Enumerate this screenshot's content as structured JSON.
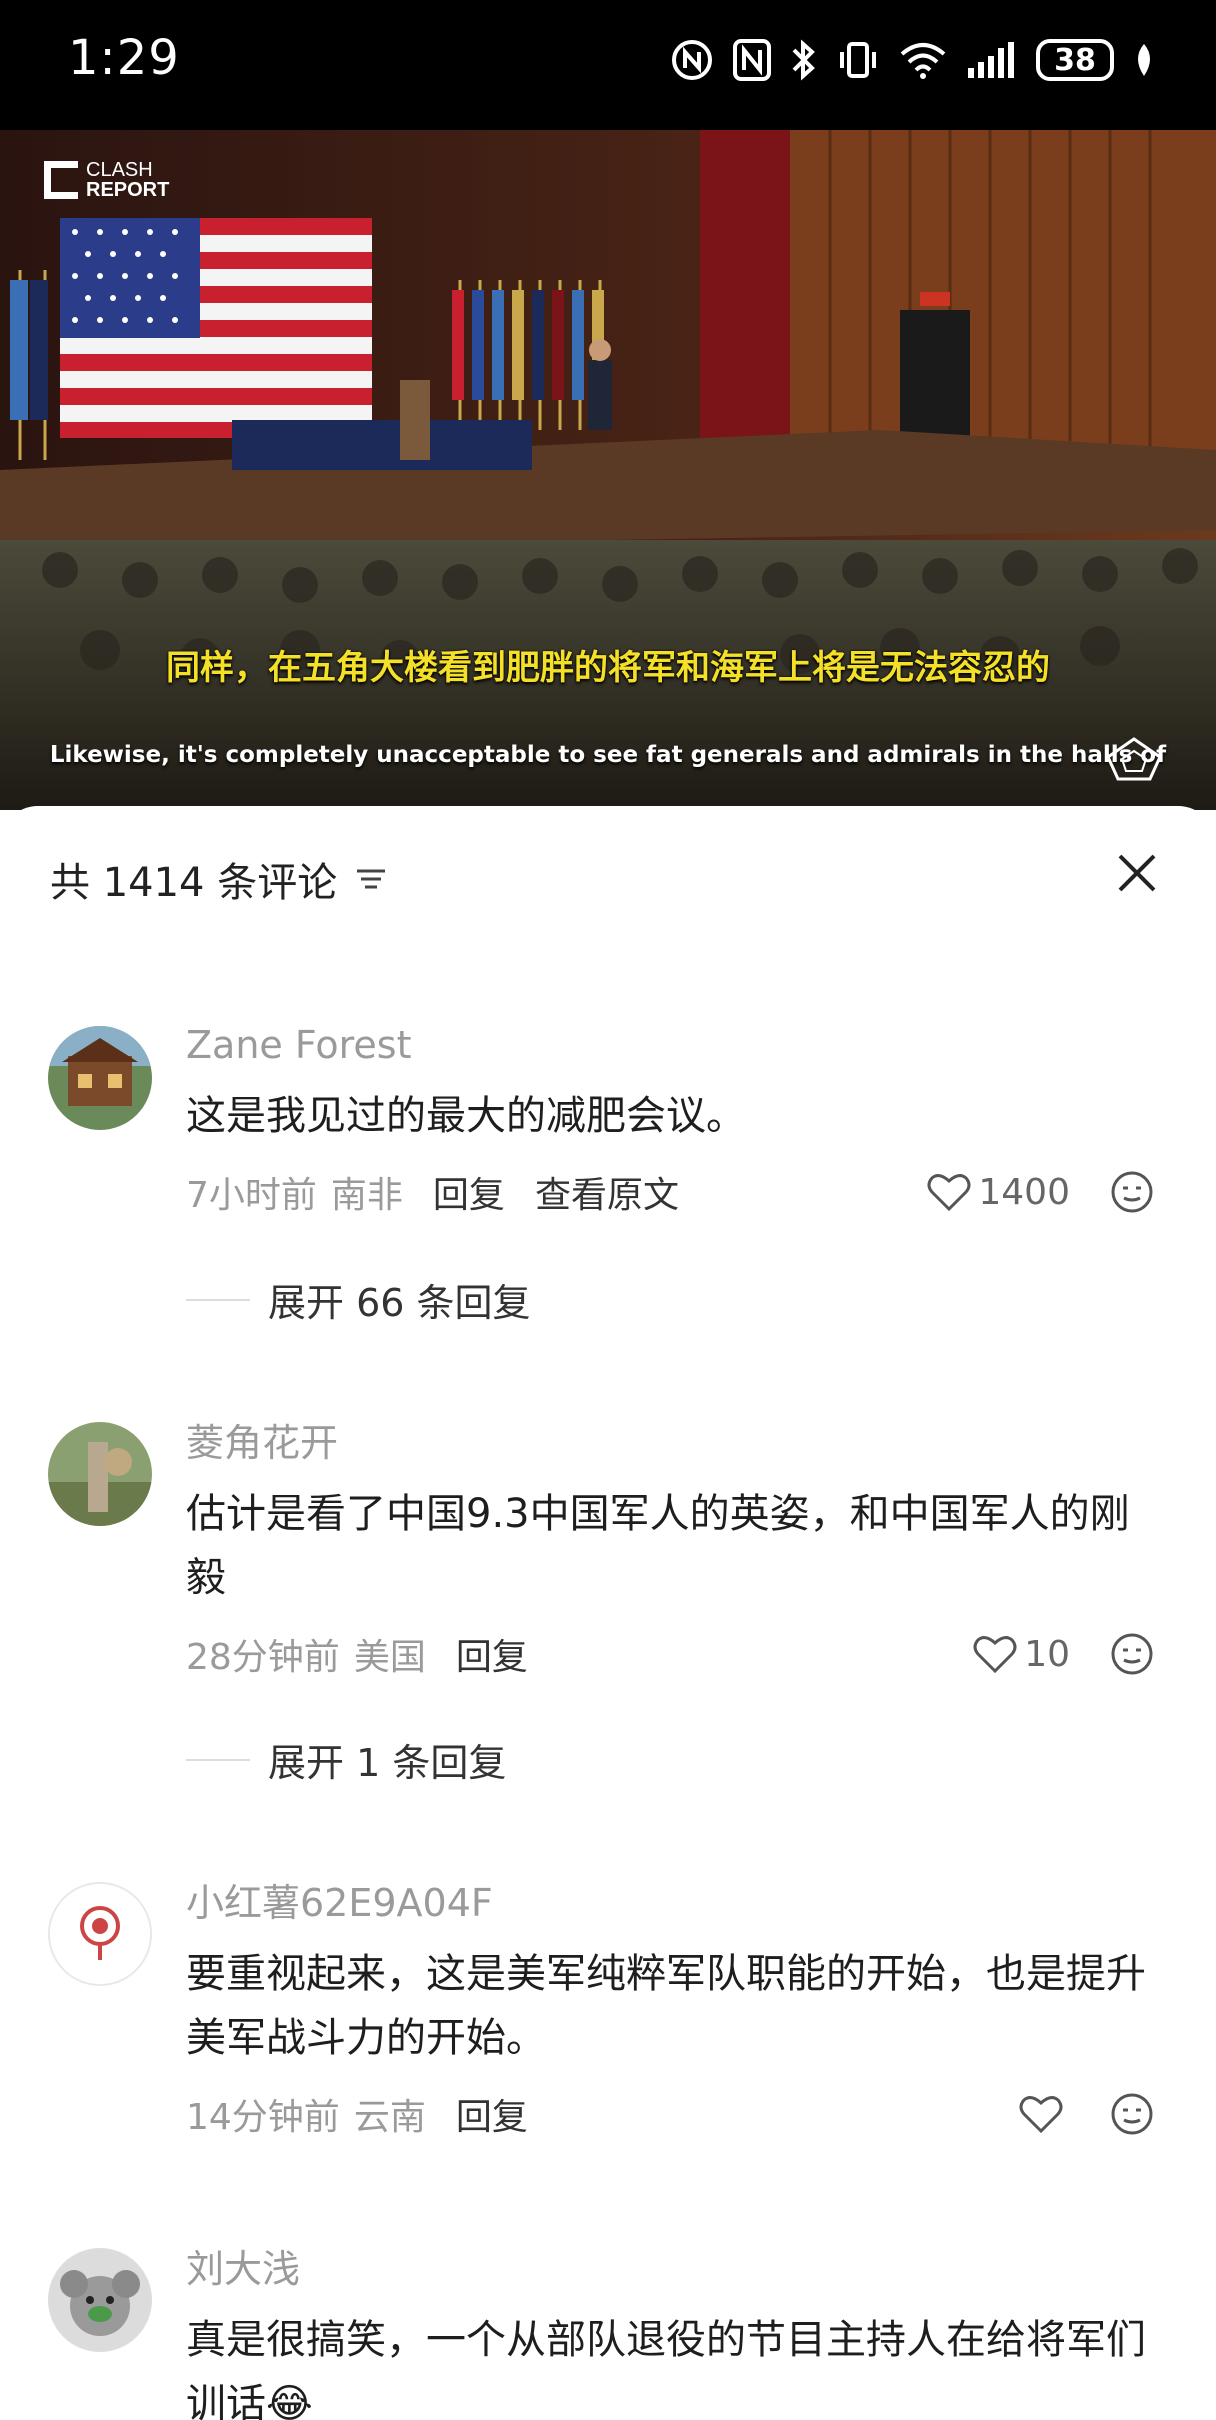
{
  "status_bar": {
    "time": "1:29",
    "battery": "38"
  },
  "video": {
    "brand_line1": "CLASH",
    "brand_line2": "REPORT",
    "subtitle_zh": "同样，在五角大楼看到肥胖的将军和海军上将是无法容忍的",
    "subtitle_en": "Likewise, it's completely unacceptable to see fat generals and admirals in the halls of"
  },
  "comments_panel": {
    "title": "共 1414 条评论",
    "comments": [
      {
        "user": "Zane Forest",
        "text": "这是我见过的最大的减肥会议。",
        "time": "7小时前",
        "location": "南非",
        "reply": "回复",
        "view_original": "查看原文",
        "likes": "1400",
        "expand": "展开 66 条回复"
      },
      {
        "user": "菱角花开",
        "text": "估计是看了中国9.3中国军人的英姿，和中国军人的刚毅",
        "time": "28分钟前",
        "location": "美国",
        "reply": "回复",
        "likes": "10",
        "expand": "展开 1 条回复"
      },
      {
        "user": "小红薯62E9A04F",
        "text": "要重视起来，这是美军纯粹军队职能的开始，也是提升美军战斗力的开始。",
        "time": "14分钟前",
        "location": "云南",
        "reply": "回复",
        "likes": ""
      },
      {
        "user": "刘大浅",
        "text": "真是很搞笑，一个从部队退役的节目主持人在给将军们训话😂"
      }
    ]
  },
  "colors": {
    "subtitle": "#f5e028",
    "muted": "#9a9a9a"
  }
}
